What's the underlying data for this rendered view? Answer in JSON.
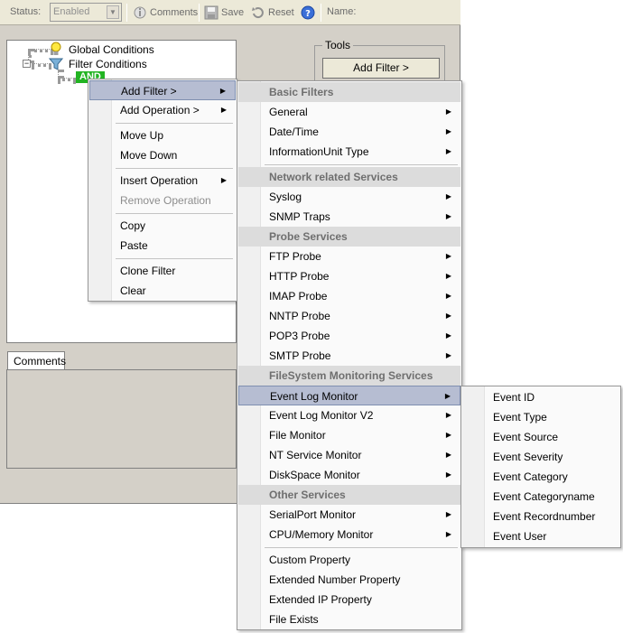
{
  "toolbar": {
    "status_label": "Status:",
    "status_value": "Enabled",
    "comments_label": "Comments",
    "save_label": "Save",
    "reset_label": "Reset",
    "name_label": "Name:"
  },
  "tree": {
    "global_conditions": "Global Conditions",
    "filter_conditions": "Filter Conditions",
    "and_node": "AND"
  },
  "tools": {
    "title": "Tools",
    "add_filter_button": "Add Filter >"
  },
  "comments_tab": "Comments",
  "context_menu": {
    "items": [
      "Add Filter >",
      "Add Operation >",
      "Move Up",
      "Move Down",
      "Insert Operation",
      "Remove Operation",
      "Copy",
      "Paste",
      "Clone Filter",
      "Clear"
    ]
  },
  "filter_menu": {
    "headers": [
      "Basic Filters",
      "Network related Services",
      "Probe Services",
      "FileSystem Monitoring Services",
      "Other Services"
    ],
    "items": [
      "General",
      "Date/Time",
      "InformationUnit Type",
      "Syslog",
      "SNMP Traps",
      "FTP Probe",
      "HTTP Probe",
      "IMAP Probe",
      "NNTP Probe",
      "POP3 Probe",
      "SMTP Probe",
      "Event Log Monitor",
      "Event Log Monitor V2",
      "File Monitor",
      "NT Service Monitor",
      "DiskSpace Monitor",
      "SerialPort Monitor",
      "CPU/Memory Monitor",
      "Custom Property",
      "Extended Number Property",
      "Extended IP Property",
      "File Exists"
    ]
  },
  "eventlog_menu": {
    "items": [
      "Event ID",
      "Event Type",
      "Event Source",
      "Event Severity",
      "Event Category",
      "Event Categoryname",
      "Event Recordnumber",
      "Event User"
    ]
  },
  "submenu_arrow": "▶"
}
